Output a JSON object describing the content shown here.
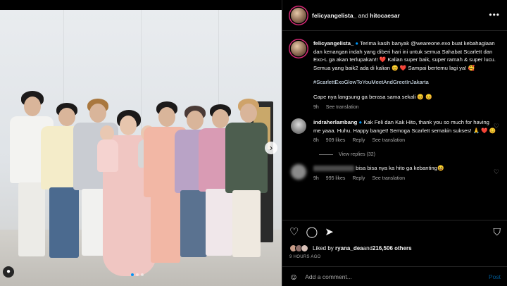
{
  "header": {
    "author": "felicyangelista_",
    "joiner": " and ",
    "collaborator": "hitocaesar",
    "more_icon": "more-horizontal-icon"
  },
  "caption": {
    "username": "felicyangelista_",
    "badge_icon": "verified-badge-icon",
    "paragraph1": "Terima kasih banyak @weareone.exo buat kebahagiaan dan kenangan indah yang diberi hari ini untuk semua Sahabat Scarlett dan Exo-L ga akan terlupakan!! ❤️  Kalian super baik, super ramah & super lucu. Semua yang baik2 ada di kalian 😊 ❤️  Sampai bertemu lagi ya! 🥰",
    "hashtag": "#ScarlettExoGlowToYouMeetAndGreetInJakarta",
    "paragraph3": "Cape nya langsung ga berasa sama sekali 😊 😊",
    "age": "9h",
    "see_translation": "See translation"
  },
  "comments": [
    {
      "username": "indraherlambang",
      "badge_icon": "verified-badge-icon",
      "text": "Kak Feli dan Kak Hito, thank you so much for having me yaaa. Huhu. Happy banget! Semoga Scarlett semakin sukses! 🙏 ❤️ 😊",
      "age": "8h",
      "likes": "909 likes",
      "reply": "Reply",
      "see_translation": "See translation",
      "view_replies": "View replies (32)"
    },
    {
      "text": "bisa bisa nya ka hito ga kebanting😆",
      "age": "9h",
      "likes": "995 likes",
      "reply": "Reply",
      "see_translation": "See translation"
    }
  ],
  "actions": {
    "like_icon": "heart-icon",
    "comment_icon": "comment-icon",
    "share_icon": "share-icon",
    "save_icon": "bookmark-icon"
  },
  "likes": {
    "prefix": "Liked by ",
    "user": "ryana_dea",
    "middle": " and ",
    "count": "216,506 others"
  },
  "timestamp": "9 HOURS AGO",
  "add_comment": {
    "emoji_icon": "emoji-icon",
    "placeholder": "Add a comment...",
    "post_label": "Post"
  },
  "media": {
    "next_icon": "chevron-right-icon",
    "tag_icon": "user-tag-icon",
    "carousel_total": 3,
    "carousel_index": 1
  },
  "colors": {
    "background": "#000000",
    "link": "#0095f6",
    "heart": "#ff3040",
    "secondary_text": "#a8a8a8"
  }
}
